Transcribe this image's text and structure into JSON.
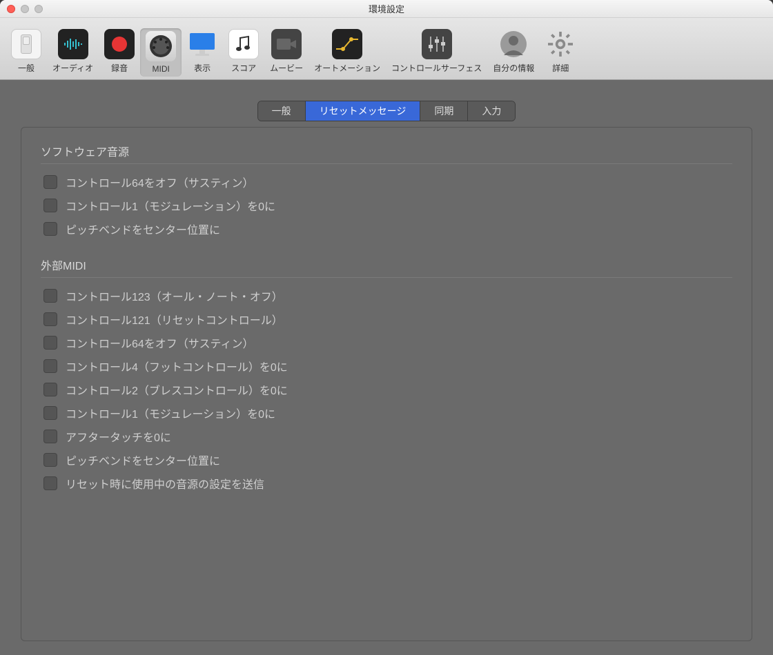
{
  "window": {
    "title": "環境設定"
  },
  "toolbar": {
    "items": [
      {
        "id": "general",
        "label": "一般"
      },
      {
        "id": "audio",
        "label": "オーディオ"
      },
      {
        "id": "record",
        "label": "録音"
      },
      {
        "id": "midi",
        "label": "MIDI"
      },
      {
        "id": "display",
        "label": "表示"
      },
      {
        "id": "score",
        "label": "スコア"
      },
      {
        "id": "movie",
        "label": "ムービー"
      },
      {
        "id": "automation",
        "label": "オートメーション"
      },
      {
        "id": "control-surfaces",
        "label": "コントロールサーフェス"
      },
      {
        "id": "my-info",
        "label": "自分の情報"
      },
      {
        "id": "advanced",
        "label": "詳細"
      }
    ],
    "active": "midi"
  },
  "tabs": {
    "items": [
      {
        "id": "general",
        "label": "一般"
      },
      {
        "id": "reset",
        "label": "リセットメッセージ"
      },
      {
        "id": "sync",
        "label": "同期"
      },
      {
        "id": "input",
        "label": "入力"
      }
    ],
    "selected": "reset"
  },
  "sections": {
    "software": {
      "title": "ソフトウェア音源",
      "items": [
        {
          "label": "コントロール64をオフ（サスティン）",
          "checked": false
        },
        {
          "label": "コントロール1（モジュレーション）を0に",
          "checked": false
        },
        {
          "label": "ピッチベンドをセンター位置に",
          "checked": false
        }
      ]
    },
    "external": {
      "title": "外部MIDI",
      "items": [
        {
          "label": "コントロール123（オール・ノート・オフ）",
          "checked": false
        },
        {
          "label": "コントロール121（リセットコントロール）",
          "checked": false
        },
        {
          "label": "コントロール64をオフ（サスティン）",
          "checked": false
        },
        {
          "label": "コントロール4（フットコントロール）を0に",
          "checked": false
        },
        {
          "label": "コントロール2（ブレスコントロール）を0に",
          "checked": false
        },
        {
          "label": "コントロール1（モジュレーション）を0に",
          "checked": false
        },
        {
          "label": "アフタータッチを0に",
          "checked": false
        },
        {
          "label": "ピッチベンドをセンター位置に",
          "checked": false
        },
        {
          "label": "リセット時に使用中の音源の設定を送信",
          "checked": false
        }
      ]
    }
  }
}
